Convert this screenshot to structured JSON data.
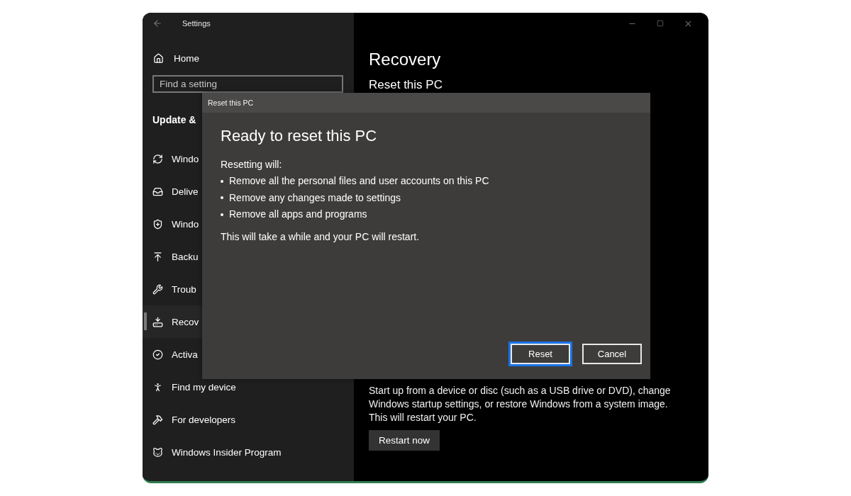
{
  "window": {
    "title": "Settings"
  },
  "sidebar": {
    "home": "Home",
    "search": {
      "placeholder": "Find a setting"
    },
    "section": "Update &",
    "items": [
      {
        "label": "Windo",
        "selected": false
      },
      {
        "label": "Delive",
        "selected": false
      },
      {
        "label": "Windo",
        "selected": false
      },
      {
        "label": "Backu",
        "selected": false
      },
      {
        "label": "Troub",
        "selected": false
      },
      {
        "label": "Recov",
        "selected": true
      },
      {
        "label": "Activa",
        "selected": false
      },
      {
        "label": "Find my device",
        "selected": false
      },
      {
        "label": "For developers",
        "selected": false
      },
      {
        "label": "Windows Insider Program",
        "selected": false
      }
    ]
  },
  "main": {
    "title": "Recovery",
    "subtitle": "Reset this PC",
    "description": "Start up from a device or disc (such as a USB drive or DVD), change Windows startup settings, or restore Windows from a system image. This will restart your PC.",
    "button": "Restart now"
  },
  "dialog": {
    "title": "Reset this PC",
    "heading": "Ready to reset this PC",
    "intro": "Resetting will:",
    "bullets": [
      "Remove all the personal files and user accounts on this PC",
      "Remove any changes made to settings",
      "Remove all apps and programs"
    ],
    "note": "This will take a while and your PC will restart.",
    "buttons": [
      {
        "label": "Reset",
        "focused": true
      },
      {
        "label": "Cancel",
        "focused": false
      }
    ]
  }
}
